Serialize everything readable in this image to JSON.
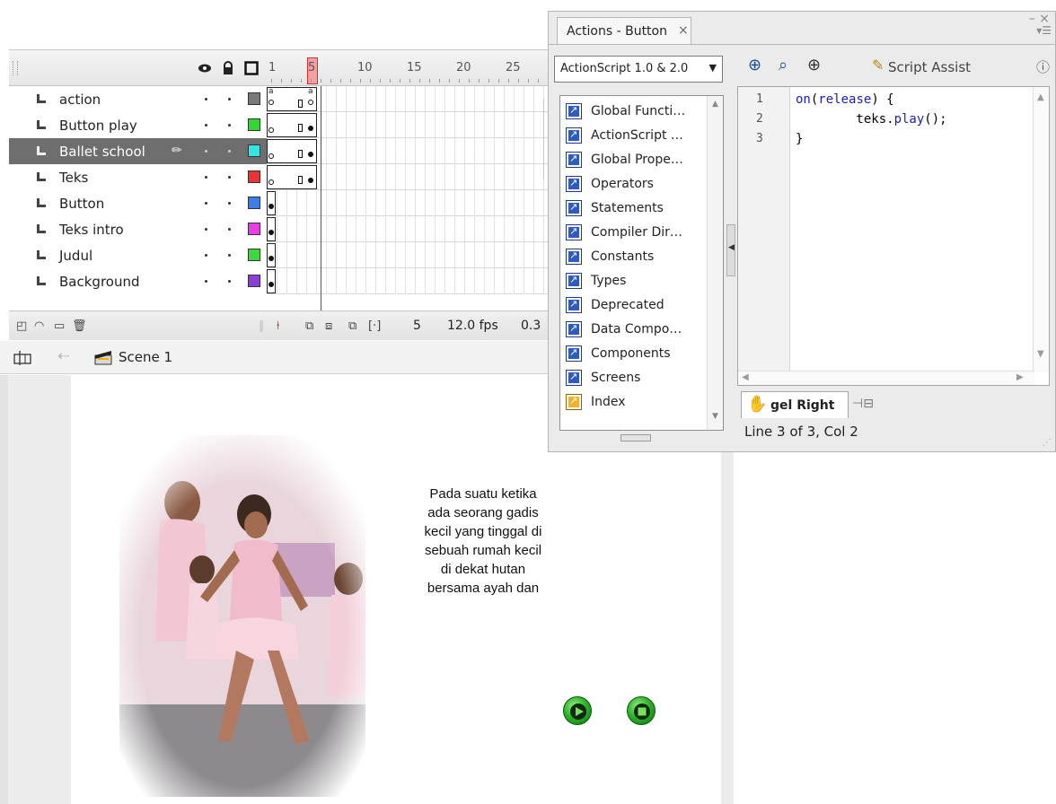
{
  "timeline": {
    "ruler_numbers": [
      "1",
      "5",
      "10",
      "15",
      "20",
      "25"
    ],
    "layers": [
      {
        "name": "action",
        "color": "#7a7a7a",
        "selected": false
      },
      {
        "name": "Button play",
        "color": "#33d633",
        "selected": false
      },
      {
        "name": "Ballet school",
        "color": "#33e5e5",
        "selected": true
      },
      {
        "name": "Teks",
        "color": "#e83434",
        "selected": false
      },
      {
        "name": "Button",
        "color": "#3d7de8",
        "selected": false
      },
      {
        "name": "Teks intro",
        "color": "#e83ee8",
        "selected": false
      },
      {
        "name": "Judul",
        "color": "#3fd63f",
        "selected": false
      },
      {
        "name": "Background",
        "color": "#8a3ed6",
        "selected": false
      }
    ],
    "footer": {
      "current_frame": "5",
      "frame_rate": "12.0 fps",
      "elapsed_time": "0.3"
    }
  },
  "editbar": {
    "scene_label": "Scene 1"
  },
  "stage": {
    "story_lines": [
      "Pada suatu ketika",
      "ada seorang gadis",
      "kecil yang tinggal di",
      "sebuah rumah kecil",
      "di dekat hutan",
      "bersama ayah dan"
    ],
    "buttons": [
      "play-icon",
      "stop-icon"
    ]
  },
  "actions_panel": {
    "tab_title": "Actions - Button",
    "version_select": "ActionScript 1.0 & 2.0",
    "toolbox_items": [
      {
        "label": "Global Functi…",
        "icon": "book-icon"
      },
      {
        "label": "ActionScript …",
        "icon": "book-icon"
      },
      {
        "label": "Global Prope…",
        "icon": "book-icon"
      },
      {
        "label": "Operators",
        "icon": "book-icon"
      },
      {
        "label": "Statements",
        "icon": "book-icon"
      },
      {
        "label": "Compiler Dir…",
        "icon": "book-icon"
      },
      {
        "label": "Constants",
        "icon": "book-icon"
      },
      {
        "label": "Types",
        "icon": "book-icon"
      },
      {
        "label": "Deprecated",
        "icon": "book-icon"
      },
      {
        "label": "Data Compo…",
        "icon": "book-icon"
      },
      {
        "label": "Components",
        "icon": "book-icon"
      },
      {
        "label": "Screens",
        "icon": "book-icon"
      },
      {
        "label": "Index",
        "icon": "index-icon"
      }
    ],
    "script_assist_label": "Script Assist",
    "code_lines": [
      {
        "num": "1",
        "pre": "",
        "kw": "on",
        "mid": "(",
        "kw2": "release",
        "post": ") {"
      },
      {
        "num": "2",
        "pre": "        teks.",
        "kw": "play",
        "mid": "();",
        "kw2": "",
        "post": ""
      },
      {
        "num": "3",
        "pre": "}",
        "kw": "",
        "mid": "",
        "kw2": "",
        "post": ""
      }
    ],
    "pinned_tab": "gel Right",
    "status": "Line 3 of 3, Col 2"
  },
  "colors": {
    "selection": "#6e6e6e",
    "playhead": "#d02020",
    "keyword": "#1d1db3",
    "button_green": "#2fb52a"
  }
}
